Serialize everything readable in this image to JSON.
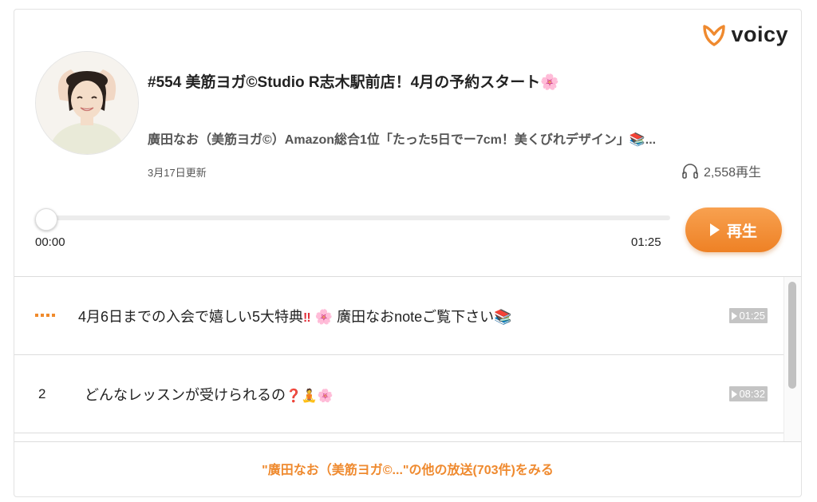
{
  "brand": {
    "name": "voicy",
    "accent": "#ef8a2f"
  },
  "episode": {
    "title": "#554 美筋ヨガ©Studio R志木駅前店！4月の予約スタート🌸",
    "subtitle": "廣田なお（美筋ヨガ©）Amazon総合1位「たった5日でー7cm！美くびれデザイン」📚...",
    "updated": "3月17日更新",
    "play_count": "2,558再生",
    "avatar_icon": "avatar-photo"
  },
  "player": {
    "current_time": "00:00",
    "total_time": "01:25",
    "progress": 0,
    "play_label": "再生"
  },
  "chapters": [
    {
      "marker": "playing",
      "title_parts": [
        "4月6日までの入会で嬉しい5大特典",
        "‼",
        " 🌸 廣田なおnoteご覧下さい📚"
      ],
      "duration": "01:25"
    },
    {
      "marker": "2",
      "title_parts": [
        "どんなレッスンが受けられるの",
        "❓",
        "🧘🌸"
      ],
      "duration": "08:32"
    }
  ],
  "footer": {
    "more_label": "\"廣田なお（美筋ヨガ©...\"の他の放送(703件)をみる"
  }
}
